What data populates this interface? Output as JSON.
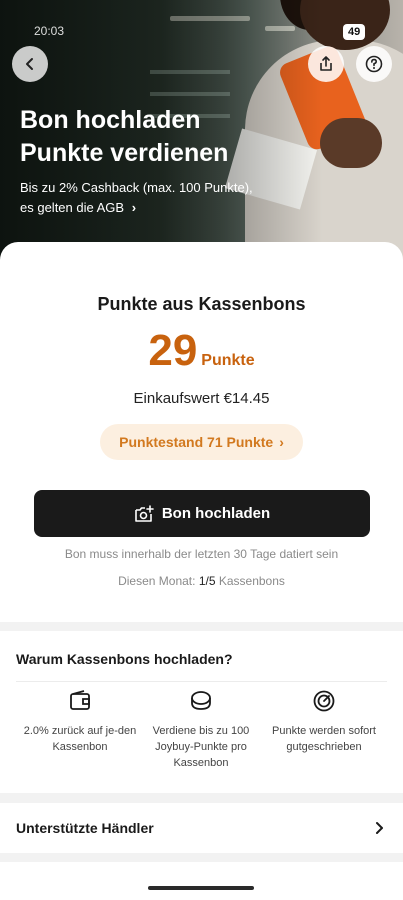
{
  "status": {
    "time": "20:03",
    "battery": "49"
  },
  "header": {
    "back_icon": "chevron-left-icon",
    "share_icon": "share-icon",
    "help_icon": "question-mark-icon",
    "title_line1": "Bon hochladen",
    "title_line2": "Punkte verdienen",
    "subtitle_line1": "Bis zu 2% Cashback (max. 100 Punkte),",
    "subtitle_line2": "es gelten die AGB",
    "subtitle_chevron": "›"
  },
  "summary": {
    "title": "Punkte aus Kassenbons",
    "points_value": "29",
    "points_unit": "Punkte",
    "purchase_label": "Einkaufswert",
    "purchase_value": "€14.45",
    "balance_label": "Punktestand 71 Punkte",
    "balance_chevron": "›",
    "upload_label": "Bon hochladen",
    "upload_icon": "camera-plus-icon",
    "note_date": "Bon muss innerhalb der letzten 30 Tage datiert sein",
    "note_month_prefix": "Diesen Monat:",
    "note_month_count": "1/5",
    "note_month_suffix": "Kassenbons"
  },
  "why": {
    "title": "Warum Kassenbons hochladen?",
    "features": [
      {
        "icon": "wallet-icon",
        "text": "2.0% zurück auf je-den Kassenbon"
      },
      {
        "icon": "coins-icon",
        "text": "Verdiene bis zu 100 Joybuy-Punkte pro Kassenbon"
      },
      {
        "icon": "speed-gauge-icon",
        "text": "Punkte werden sofort gutgeschrieben"
      }
    ]
  },
  "merchants": {
    "label": "Unterstützte Händler",
    "chevron": "›"
  },
  "colors": {
    "accent": "#c8620e",
    "pill_bg": "#fcefe0",
    "button_bg": "#1a1a1a"
  }
}
